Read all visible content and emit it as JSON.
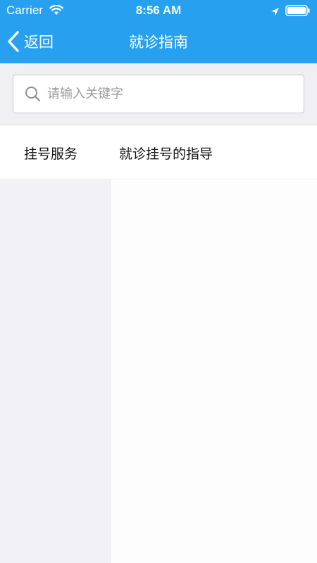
{
  "status_bar": {
    "carrier": "Carrier",
    "time": "8:56 AM"
  },
  "nav": {
    "back_label": "返回",
    "title": "就诊指南"
  },
  "search": {
    "placeholder": "请输入关键字",
    "value": ""
  },
  "tabs": [
    {
      "label": "挂号服务"
    },
    {
      "label": "就诊挂号的指导"
    }
  ],
  "colors": {
    "header_bg": "#27a0f0",
    "page_bg": "#efeff4",
    "left_panel_bg": "#f2f1f5"
  },
  "icons": {
    "back": "chevron-left-icon",
    "search": "search-icon",
    "wifi": "wifi-icon",
    "location": "location-arrow-icon",
    "battery": "battery-icon"
  }
}
